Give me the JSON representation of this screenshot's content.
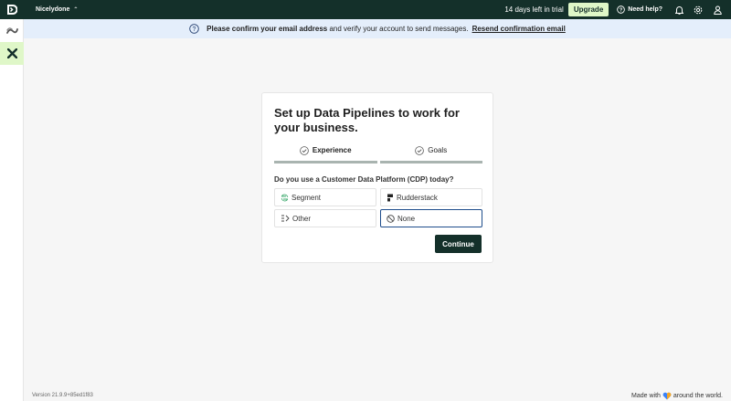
{
  "topbar": {
    "workspace": "Nicelydone",
    "trial_text": "14 days left in trial",
    "upgrade_label": "Upgrade",
    "help_label": "Need help?"
  },
  "banner": {
    "bold_text": "Please confirm your email address",
    "text": "and verify your account to send messages.",
    "link_text": "Resend confirmation email"
  },
  "card": {
    "title": "Set up Data Pipelines to work for your business.",
    "steps": [
      {
        "label": "Experience"
      },
      {
        "label": "Goals"
      }
    ],
    "question": "Do you use a Customer Data Platform (CDP) today?",
    "options": [
      {
        "label": "Segment",
        "icon": "segment-icon"
      },
      {
        "label": "Rudderstack",
        "icon": "rudderstack-icon"
      },
      {
        "label": "Other",
        "icon": "other-icon"
      },
      {
        "label": "None",
        "icon": "none-icon"
      }
    ],
    "selected_option": "None",
    "continue_label": "Continue"
  },
  "footer": {
    "version": "Version 21.9.9+85ed1f83",
    "made_with": "Made with",
    "around": "around the world."
  },
  "colors": {
    "topbar": "#14302a",
    "accent": "#dff7c8",
    "banner": "#e4eefb",
    "selected_border": "#1e4d8c"
  }
}
